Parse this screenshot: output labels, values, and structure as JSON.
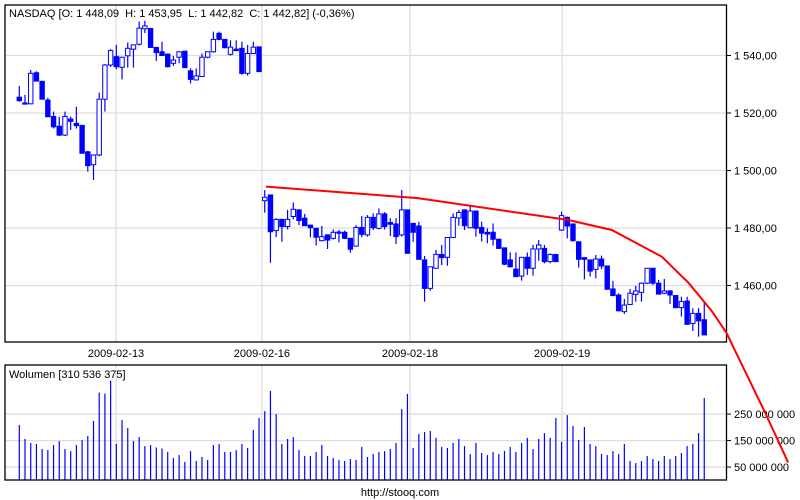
{
  "header": {
    "title": "NASDAQ [O: 1 448,09  H: 1 453,95  L: 1 442,82  C: 1 442,82] (-0,36%)",
    "volume_title": "Wolumen [310 536 375]",
    "footer_link": "http://stooq.com"
  },
  "colors": {
    "candle": "#0000ff",
    "trend": "#ff0000",
    "grid": "#dddddd",
    "volume": "#0000ff"
  },
  "chart_data": [
    {
      "type": "candlestick",
      "title": "NASDAQ",
      "summary": {
        "open": 1448.09,
        "high": 1453.95,
        "low": 1442.82,
        "close": 1442.82,
        "change_pct": -0.36
      },
      "ylim": [
        1438.8,
        1557.2
      ],
      "yticks": [
        1460,
        1480,
        1500,
        1520,
        1540
      ],
      "ytick_labels": [
        "1 460,00",
        "1 480,00",
        "1 500,00",
        "1 520,00",
        "1 540,00"
      ],
      "xticks_index": [
        16.95,
        42.5,
        68.45,
        95.1
      ],
      "xtick_labels": [
        "2009-02-13",
        "2009-02-16",
        "2009-02-18",
        "2009-02-19"
      ],
      "grid": true,
      "ohlc": [
        [
          1525.5,
          1529.4,
          1523.9,
          1524.3
        ],
        [
          1523.5,
          1526.3,
          1523,
          1523.2
        ],
        [
          1523.2,
          1535,
          1523,
          1533.8
        ],
        [
          1534,
          1534.5,
          1531,
          1531.1
        ],
        [
          1531,
          1531.2,
          1524.8,
          1524.8
        ],
        [
          1524.5,
          1525.3,
          1518.7,
          1518.7
        ],
        [
          1518.8,
          1520.5,
          1514.6,
          1515.2
        ],
        [
          1515.4,
          1518.7,
          1512,
          1512.3
        ],
        [
          1512.3,
          1520.5,
          1512,
          1518.8
        ],
        [
          1517.9,
          1518.8,
          1514.1,
          1517.1
        ],
        [
          1516.4,
          1522.2,
          1514.6,
          1515.6
        ],
        [
          1515.7,
          1515.7,
          1506,
          1506
        ],
        [
          1506.5,
          1506.8,
          1499.6,
          1501.7
        ],
        [
          1502,
          1505.4,
          1496.7,
          1505.4
        ],
        [
          1505.4,
          1527.1,
          1505,
          1524.8
        ],
        [
          1524.8,
          1537,
          1520.5,
          1536.7
        ],
        [
          1536.7,
          1542.2,
          1536,
          1541.7
        ],
        [
          1539.6,
          1543.7,
          1535.2,
          1536.1
        ],
        [
          1535.9,
          1539.4,
          1531.7,
          1539.4
        ],
        [
          1539.9,
          1544.5,
          1535.8,
          1542.5
        ],
        [
          1542.2,
          1543.7,
          1535.8,
          1543.7
        ],
        [
          1543.9,
          1551.8,
          1543.5,
          1549.5
        ],
        [
          1549.3,
          1552.1,
          1547.8,
          1550.3
        ],
        [
          1549.4,
          1549.6,
          1542.8,
          1542.8
        ],
        [
          1542.8,
          1543,
          1538.1,
          1541
        ],
        [
          1541.3,
          1544.8,
          1539.8,
          1540
        ],
        [
          1540.5,
          1540.5,
          1535.8,
          1536.1
        ],
        [
          1537.3,
          1539.8,
          1536.4,
          1538.4
        ],
        [
          1539.4,
          1541.5,
          1537.3,
          1541.3
        ],
        [
          1541.5,
          1541.5,
          1535.8,
          1535.8
        ],
        [
          1534.7,
          1535.5,
          1530.3,
          1531.7
        ],
        [
          1531.5,
          1535.5,
          1531.3,
          1532.9
        ],
        [
          1532.7,
          1540.7,
          1532.5,
          1539.4
        ],
        [
          1539.4,
          1541.3,
          1539,
          1541.3
        ],
        [
          1541.3,
          1548.3,
          1541,
          1545.6
        ],
        [
          1547.7,
          1548.3,
          1545.3,
          1545.6
        ],
        [
          1545.6,
          1545.6,
          1542.5,
          1542.7
        ],
        [
          1540.4,
          1545.3,
          1540,
          1542.9
        ],
        [
          1542.2,
          1545.3,
          1541.6,
          1541.7
        ],
        [
          1542.5,
          1544.8,
          1533.3,
          1533.8
        ],
        [
          1533.8,
          1543.6,
          1533,
          1540.7
        ],
        [
          1540.7,
          1544.8,
          1540.5,
          1542.9
        ],
        [
          1543,
          1543,
          1534.4,
          1534.4
        ],
        [
          1489.5,
          1493.2,
          1485.3,
          1490.7
        ],
        [
          1491.5,
          1491.5,
          1467.9,
          1478.7
        ],
        [
          1479.1,
          1483.4,
          1476.8,
          1483
        ],
        [
          1483,
          1483.2,
          1475.2,
          1480.5
        ],
        [
          1480.5,
          1486.3,
          1479.5,
          1483
        ],
        [
          1484,
          1488.9,
          1483,
          1486.5
        ],
        [
          1486.3,
          1486.5,
          1481,
          1482.6
        ],
        [
          1483.4,
          1484.9,
          1480.8,
          1480.8
        ],
        [
          1481,
          1481,
          1476.8,
          1480.1
        ],
        [
          1479.9,
          1479.9,
          1473.9,
          1476.8
        ],
        [
          1475.6,
          1480.7,
          1475.4,
          1477
        ],
        [
          1477.6,
          1477.8,
          1472.7,
          1475.8
        ],
        [
          1476.4,
          1479.5,
          1476,
          1478.5
        ],
        [
          1478.6,
          1479.3,
          1475,
          1478.4
        ],
        [
          1478.5,
          1479.1,
          1476.2,
          1476.4
        ],
        [
          1476.4,
          1476.6,
          1471.4,
          1472.6
        ],
        [
          1473.7,
          1481,
          1473.5,
          1480.2
        ],
        [
          1480.2,
          1484.2,
          1476.8,
          1477.8
        ],
        [
          1477.6,
          1484.5,
          1477,
          1483.7
        ],
        [
          1483.7,
          1485.1,
          1479.3,
          1480.1
        ],
        [
          1479.9,
          1486.8,
          1479.5,
          1484.9
        ],
        [
          1484.9,
          1485.5,
          1479.5,
          1480.5
        ],
        [
          1481.9,
          1483.4,
          1477.2,
          1481.3
        ],
        [
          1481.4,
          1483.4,
          1474.4,
          1477
        ],
        [
          1477.6,
          1493.2,
          1477,
          1486.3
        ],
        [
          1486.3,
          1486.3,
          1471.2,
          1471.2
        ],
        [
          1481.6,
          1481.8,
          1475.2,
          1478.5
        ],
        [
          1480.7,
          1482.2,
          1469.1,
          1469.1
        ],
        [
          1468.9,
          1470.3,
          1454.4,
          1459
        ],
        [
          1459,
          1466.5,
          1458.2,
          1466.5
        ],
        [
          1466,
          1472.4,
          1466,
          1470.8
        ],
        [
          1470.8,
          1474.1,
          1467.1,
          1469.7
        ],
        [
          1469.8,
          1476.7,
          1466.9,
          1476.7
        ],
        [
          1476.7,
          1485.1,
          1476.5,
          1483.7
        ],
        [
          1483.5,
          1486.3,
          1480.8,
          1485.4
        ],
        [
          1486.3,
          1486.5,
          1479.3,
          1480.8
        ],
        [
          1480.1,
          1488,
          1479.9,
          1485.9
        ],
        [
          1485.9,
          1486,
          1477,
          1479.9
        ],
        [
          1480.2,
          1482.2,
          1475.3,
          1478.2
        ],
        [
          1478.5,
          1479.9,
          1474.7,
          1477.9
        ],
        [
          1478.5,
          1481.6,
          1473.9,
          1476.1
        ],
        [
          1476.1,
          1476.1,
          1472.9,
          1472.9
        ],
        [
          1473.1,
          1473.1,
          1467.1,
          1467.4
        ],
        [
          1468.9,
          1471.5,
          1466.3,
          1466.5
        ],
        [
          1465.7,
          1471.5,
          1463,
          1463.1
        ],
        [
          1463.3,
          1469.8,
          1461.7,
          1469.8
        ],
        [
          1469.8,
          1471.5,
          1463.7,
          1466
        ],
        [
          1466,
          1474.1,
          1463.4,
          1472.7
        ],
        [
          1472.7,
          1475.8,
          1468.6,
          1474.1
        ],
        [
          1472.9,
          1474.1,
          1467.7,
          1468.3
        ],
        [
          1468.3,
          1471.2,
          1467.7,
          1470.8
        ],
        [
          1470.8,
          1470.8,
          1468.3,
          1468.3
        ],
        [
          1479.3,
          1485.7,
          1479,
          1484.3
        ],
        [
          1483.7,
          1484,
          1476.4,
          1480.7
        ],
        [
          1481.4,
          1481.6,
          1475.2,
          1475.6
        ],
        [
          1475.2,
          1475.4,
          1466.2,
          1469.1
        ],
        [
          1469.7,
          1469.9,
          1462.1,
          1469.1
        ],
        [
          1468.9,
          1469,
          1463.1,
          1465
        ],
        [
          1465.6,
          1470.6,
          1462.5,
          1469.2
        ],
        [
          1469.2,
          1470.4,
          1465.7,
          1466.8
        ],
        [
          1466.8,
          1466.8,
          1458.5,
          1458.7
        ],
        [
          1458.8,
          1461.6,
          1456.3,
          1456.5
        ],
        [
          1456.7,
          1457.3,
          1451,
          1451.2
        ],
        [
          1450.9,
          1455.3,
          1450.1,
          1453.2
        ],
        [
          1453.4,
          1458.8,
          1453.2,
          1457.3
        ],
        [
          1456.9,
          1459.9,
          1454.4,
          1458.1
        ],
        [
          1457.6,
          1461.1,
          1454.4,
          1460.8
        ],
        [
          1460.8,
          1466,
          1460.5,
          1466
        ],
        [
          1466,
          1466,
          1460.2,
          1460.8
        ],
        [
          1460.8,
          1461.9,
          1457,
          1457
        ],
        [
          1457.3,
          1462.3,
          1457,
          1458.1
        ],
        [
          1458.1,
          1458.4,
          1453.6,
          1456.7
        ],
        [
          1456.5,
          1456.7,
          1452.1,
          1452.3
        ],
        [
          1452.3,
          1456.1,
          1449.2,
          1454.4
        ],
        [
          1454.6,
          1456.1,
          1446.3,
          1446.5
        ],
        [
          1446.8,
          1452.1,
          1444.2,
          1450.3
        ],
        [
          1450.3,
          1452.1,
          1442.2,
          1447.7
        ],
        [
          1448.09,
          1453.95,
          1442.82,
          1442.82
        ]
      ],
      "trendline": [
        [
          43.2,
          1494.4
        ],
        [
          69.8,
          1490.4
        ],
        [
          96.2,
          1482.8
        ],
        [
          103.8,
          1479.3
        ],
        [
          112.6,
          1470.0
        ],
        [
          117.3,
          1460.8
        ],
        [
          121.4,
          1450.9
        ],
        [
          123.9,
          1443.5
        ],
        [
          126.2,
          1434.1
        ],
        [
          130.6,
          1416.0
        ],
        [
          134.7,
          1398.4
        ]
      ]
    },
    {
      "type": "bar",
      "title": "Wolumen",
      "last_value": 310536375,
      "yticks": [
        50000000,
        150000000,
        250000000
      ],
      "ytick_labels": [
        "50 000 000",
        "150 000 000",
        "250 000 000"
      ],
      "values_millions": [
        209,
        156,
        141,
        137,
        118,
        114,
        133,
        148,
        118,
        110,
        133,
        152,
        167,
        224,
        331,
        327,
        376,
        137,
        227,
        197,
        148,
        163,
        129,
        133,
        124,
        120,
        107,
        84,
        95,
        69,
        110,
        73,
        88,
        77,
        133,
        137,
        107,
        107,
        114,
        137,
        122,
        190,
        235,
        261,
        337,
        250,
        137,
        156,
        163,
        114,
        92,
        92,
        107,
        133,
        92,
        84,
        77,
        73,
        80,
        77,
        126,
        88,
        99,
        107,
        110,
        118,
        141,
        269,
        326,
        122,
        175,
        182,
        186,
        160,
        126,
        122,
        141,
        156,
        129,
        99,
        141,
        103,
        95,
        107,
        99,
        111,
        126,
        107,
        141,
        160,
        118,
        156,
        178,
        160,
        235,
        145,
        246,
        205,
        152,
        201,
        137,
        129,
        99,
        95,
        110,
        99,
        137,
        73,
        65,
        73,
        92,
        80,
        73,
        92,
        80,
        92,
        103,
        129,
        137,
        178,
        310.5
      ]
    }
  ]
}
